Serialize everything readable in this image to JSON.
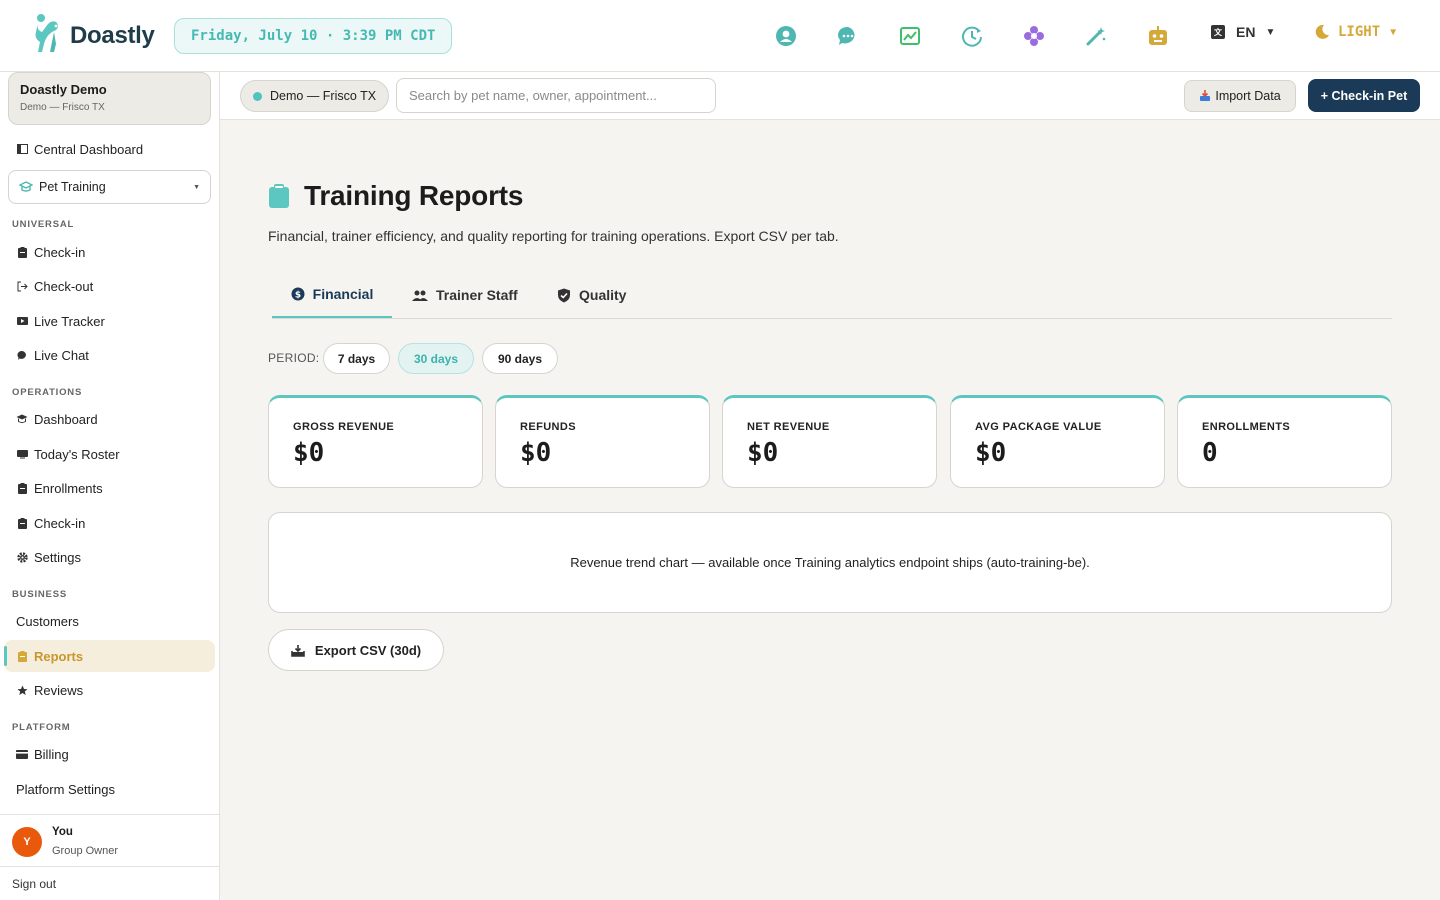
{
  "brand": {
    "name": "Doastly"
  },
  "header": {
    "datetime": "Friday, July 10 · 3:39 PM CDT",
    "icons": [
      "support-icon",
      "chat-icon",
      "analytics-icon",
      "clock-icon",
      "flower-icon",
      "magic-wand-icon",
      "robot-icon"
    ],
    "language": "EN",
    "theme": "LIGHT"
  },
  "sidebar": {
    "tenant": {
      "name": "Doastly Demo",
      "sub": "Demo — Frisco TX"
    },
    "central_dashboard": "Central Dashboard",
    "module": "Pet Training",
    "sections": {
      "universal": "UNIVERSAL",
      "operations": "OPERATIONS",
      "business": "BUSINESS",
      "platform": "PLATFORM"
    },
    "universal_items": [
      "Check-in",
      "Check-out",
      "Live Tracker",
      "Live Chat"
    ],
    "operations_items": [
      "Dashboard",
      "Today's Roster",
      "Enrollments",
      "Check-in",
      "Settings"
    ],
    "business_items": [
      "Customers",
      "Reports",
      "Reviews"
    ],
    "platform_items": [
      "Billing",
      "Platform Settings"
    ],
    "user": {
      "initial": "Y",
      "name": "You",
      "role": "Group Owner"
    },
    "sign_out": "Sign out"
  },
  "subheader": {
    "location": "Demo — Frisco TX",
    "search_placeholder": "Search by pet name, owner, appointment...",
    "import_label": "Import Data",
    "checkin_label": "+ Check-in Pet"
  },
  "page": {
    "title": "Training Reports",
    "description": "Financial, trainer efficiency, and quality reporting for training operations. Export CSV per tab.",
    "tabs": [
      "Financial",
      "Trainer Staff",
      "Quality"
    ],
    "period_label": "PERIOD:",
    "periods": [
      "7 days",
      "30 days",
      "90 days"
    ],
    "selected_period": "30 days",
    "kpis": [
      {
        "label": "GROSS REVENUE",
        "value": "$0"
      },
      {
        "label": "REFUNDS",
        "value": "$0"
      },
      {
        "label": "NET REVENUE",
        "value": "$0"
      },
      {
        "label": "AVG PACKAGE VALUE",
        "value": "$0"
      },
      {
        "label": "ENROLLMENTS",
        "value": "0"
      }
    ],
    "chart_placeholder": "Revenue trend chart — available once Training analytics endpoint ships (auto-training-be).",
    "export_label": "Export CSV (30d)"
  },
  "colors": {
    "accent": "#5cc6c0",
    "navy": "#1b3a57",
    "active_bg": "#f6eedc",
    "avatar": "#e8590c"
  }
}
